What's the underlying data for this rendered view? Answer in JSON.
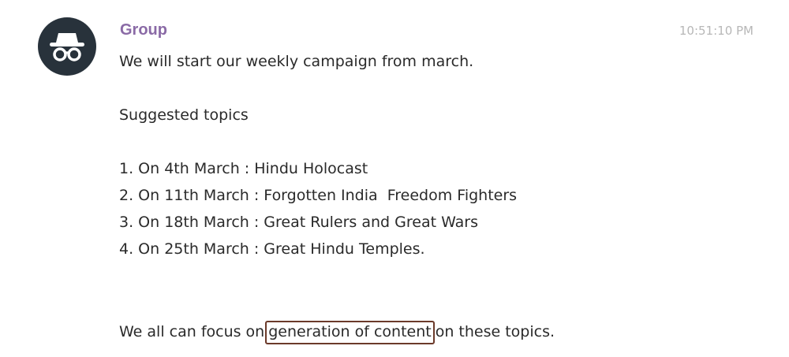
{
  "message": {
    "sender": "Group",
    "timestamp": "10:51:10 PM",
    "avatar_icon": "incognito-icon",
    "intro": "We will start our weekly campaign from march.",
    "section_heading": "Suggested topics",
    "topics": [
      "1. On 4th March : Hindu Holocast",
      "2. On 11th March : Forgotten India  Freedom Fighters",
      "3. On 18th March : Great Rulers and Great Wars",
      "4. On 25th March : Great Hindu Temples."
    ],
    "closing_before": "We all can focus on",
    "closing_highlight": "generation of content",
    "closing_after": "on these topics.",
    "highlight_color": "#6b3a2a"
  }
}
